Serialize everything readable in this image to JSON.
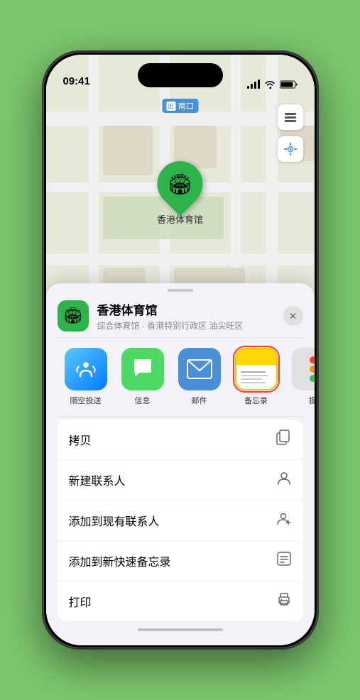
{
  "status_bar": {
    "time": "09:41",
    "location_arrow": "▶"
  },
  "map": {
    "label": "南口",
    "controls": {
      "layers": "⊞",
      "location": "➤"
    }
  },
  "pin": {
    "label": "香港体育馆",
    "emoji": "🏟"
  },
  "sheet": {
    "place_name": "香港体育馆",
    "place_subtitle": "综合体育馆 · 香港特别行政区 油尖旺区",
    "close_label": "✕"
  },
  "share_apps": [
    {
      "id": "airdrop",
      "label": "隔空投送",
      "highlighted": false
    },
    {
      "id": "messages",
      "label": "信息",
      "highlighted": false
    },
    {
      "id": "mail",
      "label": "邮件",
      "highlighted": false
    },
    {
      "id": "notes",
      "label": "备忘录",
      "highlighted": true
    },
    {
      "id": "more",
      "label": "提",
      "highlighted": false
    }
  ],
  "actions": [
    {
      "label": "拷贝",
      "icon": "copy"
    },
    {
      "label": "新建联系人",
      "icon": "person"
    },
    {
      "label": "添加到现有联系人",
      "icon": "person-add"
    },
    {
      "label": "添加到新快速备忘录",
      "icon": "note"
    },
    {
      "label": "打印",
      "icon": "print"
    }
  ],
  "colors": {
    "green_accent": "#2db34a",
    "red_highlight": "#ff3b30",
    "blue_accent": "#007aff"
  }
}
